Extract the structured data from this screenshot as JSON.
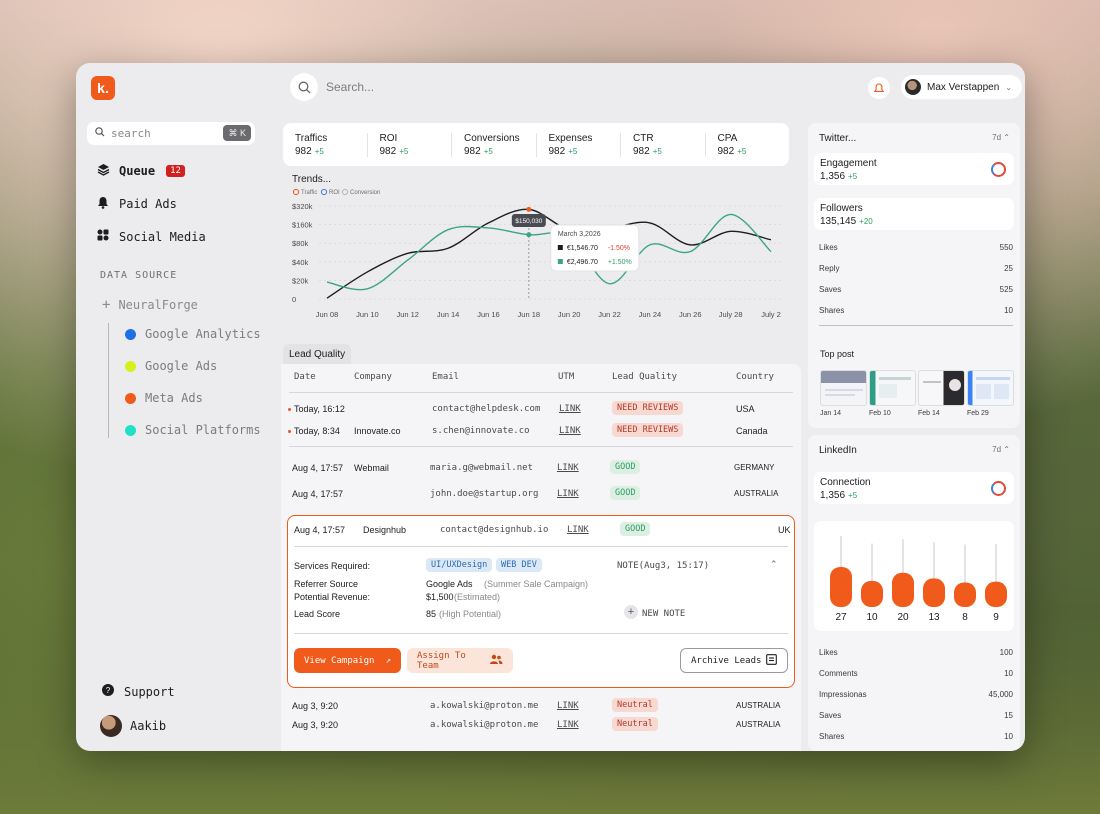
{
  "app": {
    "logo_letter": "k.",
    "sidebar_search_placeholder": "search",
    "sidebar_search_shortcut": "⌘ K",
    "nav": [
      {
        "label": "Queue",
        "badge": "12",
        "icon": "layers-icon"
      },
      {
        "label": "Paid Ads",
        "icon": "bell-icon"
      },
      {
        "label": "Social Media",
        "icon": "grid-icon"
      }
    ],
    "data_source_title": "DATA SOURCE",
    "data_source_root": "NeuralForge",
    "data_sources": [
      {
        "label": "Google Analytics",
        "color": "#1f6fe8"
      },
      {
        "label": "Google Ads",
        "color": "#d6f01a"
      },
      {
        "label": "Meta Ads",
        "color": "#f05a1a"
      },
      {
        "label": "Social Platforms",
        "color": "#20e0c8"
      }
    ],
    "support_label": "Support",
    "user_name": "Aakib"
  },
  "topbar": {
    "search_placeholder": "Search...",
    "profile_name": "Max Verstappen"
  },
  "kpis": [
    {
      "label": "Traffics",
      "value": "982",
      "delta": "+5"
    },
    {
      "label": "ROI",
      "value": "982",
      "delta": "+5"
    },
    {
      "label": "Conversions",
      "value": "982",
      "delta": "+5"
    },
    {
      "label": "Expenses",
      "value": "982",
      "delta": "+5"
    },
    {
      "label": "CTR",
      "value": "982",
      "delta": "+5"
    },
    {
      "label": "CPA",
      "value": "982",
      "delta": "+5"
    }
  ],
  "chart_data": {
    "type": "line",
    "title": "Trends...",
    "legend": [
      "Traffic",
      "ROI",
      "Conversion"
    ],
    "yticks": [
      "$320k",
      "$160k",
      "$80k",
      "$40k",
      "$20k",
      "0"
    ],
    "x": [
      "Jun 08",
      "Jun 10",
      "Jun 12",
      "Jun 14",
      "Jun 16",
      "Jun 18",
      "Jun 20",
      "Jun 22",
      "Jun 24",
      "Jun 26",
      "July 28",
      "July 2"
    ],
    "series": [
      {
        "name": "Traffic",
        "color": "#1d1d1f",
        "values": [
          0.05,
          1.6,
          2.7,
          3.0,
          4.5,
          5.3,
          4.1,
          4.2,
          4.5,
          3.2,
          4.0,
          3.5
        ]
      },
      {
        "name": "Conversion",
        "color": "#3aa585",
        "values": [
          1.0,
          0.6,
          2.3,
          4.1,
          4.2,
          3.8,
          3.7,
          0.9,
          3.2,
          2.8,
          5.0,
          2.8
        ]
      }
    ],
    "tooltip": {
      "highlight": "$150,030",
      "date": "March 3,2026",
      "rows": [
        {
          "value": "€1,546.70",
          "delta": "-1.50%",
          "color": "#1d1d1f",
          "delta_color": "#d9402e"
        },
        {
          "value": "€2,496.70",
          "delta": "+1.50%",
          "color": "#3aa585",
          "delta_color": "#2e9d64"
        }
      ]
    }
  },
  "lead": {
    "tab_label": "Lead Quality",
    "headers": [
      "Date",
      "Company",
      "Email",
      "UTM",
      "Lead Quality",
      "Country"
    ],
    "rows": [
      {
        "date": "Today, 16:12",
        "company": "",
        "email": "contact@helpdesk.com",
        "utm": "LINK",
        "quality": "NEED REVIEWS",
        "kind": "red",
        "country": "USA"
      },
      {
        "date": "Today, 8:34",
        "company": "Innovate.co",
        "email": "s.chen@innovate.co",
        "utm": "LINK",
        "quality": "NEED REVIEWS",
        "kind": "red",
        "country": "Canada"
      },
      {
        "date": "Aug 4, 17:57",
        "company": "Webmail",
        "email": "maria.g@webmail.net",
        "utm": "LINK",
        "quality": "GOOD",
        "kind": "green",
        "country": "GERMANY"
      },
      {
        "date": "Aug 4, 17:57",
        "company": "",
        "email": "john.doe@startup.org",
        "utm": "LINK",
        "quality": "GOOD",
        "kind": "green",
        "country": "AUSTRALIA"
      }
    ],
    "expanded": {
      "date": "Aug 4, 17:57",
      "company": "Designhub",
      "email": "contact@designhub.io",
      "utm": "LINK",
      "quality": "GOOD",
      "country": "UK",
      "services_label": "Services Required:",
      "services": [
        "UI/UXDesign",
        "WEB DEV"
      ],
      "note_label": "NOTE(Aug3, 15:17)",
      "referrer_label": "Referrer Source",
      "referrer_value": "Google Ads",
      "referrer_extra": "(Summer Sale Campaign)",
      "revenue_label": "Potential Revenue:",
      "revenue_value": "$1,500",
      "revenue_extra": "(Estimated)",
      "score_label": "Lead Score",
      "score_value": "85",
      "score_extra": "(High Potential)",
      "new_note": "NEW NOTE",
      "view_campaign": "View Campaign",
      "assign_team": "Assign To Team",
      "archive": "Archive Leads"
    },
    "tail_rows": [
      {
        "date": "Aug 3, 9:20",
        "email": "a.kowalski@proton.me",
        "utm": "LINK",
        "quality": "Neutral",
        "country": "AUSTRALIA"
      },
      {
        "date": "Aug 3, 9:20",
        "email": "a.kowalski@proton.me",
        "utm": "LINK",
        "quality": "Neutral",
        "country": "AUSTRALIA"
      }
    ]
  },
  "twitter": {
    "title": "Twitter...",
    "range": "7d",
    "engagement_label": "Engagement",
    "engagement_value": "1,356",
    "engagement_delta": "+5",
    "followers_label": "Followers",
    "followers_value": "135,145",
    "followers_delta": "+20",
    "stats": [
      {
        "label": "Likes",
        "value": "550"
      },
      {
        "label": "Reply",
        "value": "25"
      },
      {
        "label": "Saves",
        "value": "525"
      },
      {
        "label": "Shares",
        "value": "10"
      }
    ],
    "top_post_label": "Top post",
    "top_post_dates": [
      "Jan 14",
      "Feb 10",
      "Feb 14",
      "Feb 29"
    ]
  },
  "linkedin": {
    "title": "LinkedIn",
    "range": "7d",
    "connection_label": "Connection",
    "connection_value": "1,356",
    "connection_delta": "+5",
    "bars": [
      27,
      10,
      20,
      13,
      8,
      9
    ],
    "stats": [
      {
        "label": "Likes",
        "value": "100"
      },
      {
        "label": "Comments",
        "value": "10"
      },
      {
        "label": "Impressionas",
        "value": "45,000"
      },
      {
        "label": "Saves",
        "value": "15"
      },
      {
        "label": "Shares",
        "value": "10"
      }
    ]
  }
}
